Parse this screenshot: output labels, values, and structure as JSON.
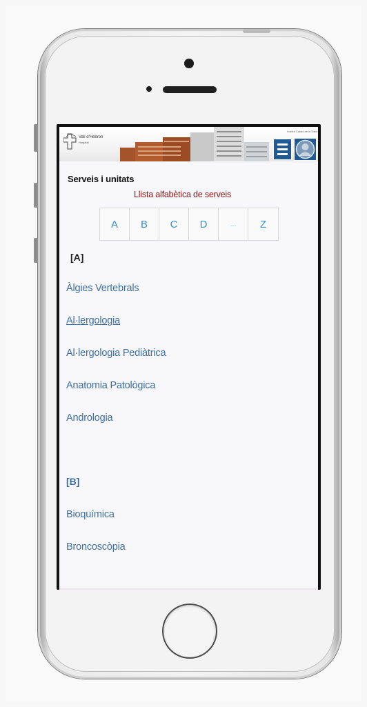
{
  "header": {
    "logo_text": "Vall d'Hebron",
    "logo_sub": "Hospital",
    "corner_text": "Institut Català de la Salut"
  },
  "page": {
    "section_title": "Serveis i unitats",
    "subtitle": "Llista alfabètica de serveis"
  },
  "alphabet": [
    "A",
    "B",
    "C",
    "D",
    "...",
    "Z"
  ],
  "groups": [
    {
      "letter": "[A]",
      "color": "#222222",
      "items": [
        "Àlgies Vertebrals",
        "Al·lergologia",
        "Al·lergologia Pediàtrica",
        "Anatomia Patològica",
        "Andrologia"
      ]
    },
    {
      "letter": "[B]",
      "color": "#3e6fa3",
      "items": [
        "Bioquímica",
        "Broncoscòpia"
      ]
    }
  ],
  "colors": {
    "brand_blue": "#1f5a96",
    "link_blue": "#3e6fa3",
    "subtitle_red": "#8b1414"
  },
  "icons": {
    "menu": "hamburger-icon",
    "user": "user-avatar-icon",
    "logo": "hospital-cross-logo-icon"
  }
}
